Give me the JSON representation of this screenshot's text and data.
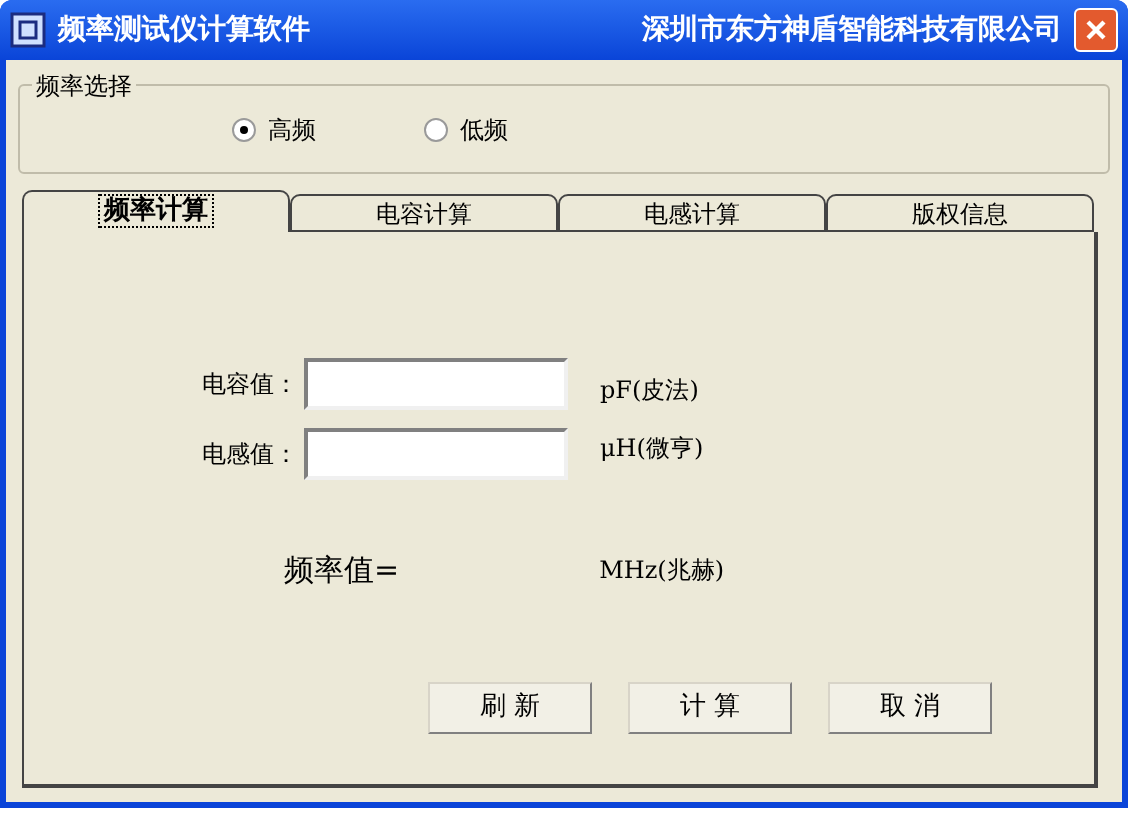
{
  "window": {
    "title": "频率测试仪计算软件",
    "company": "深圳市东方神盾智能科技有限公司"
  },
  "frequency_group": {
    "label": "频率选择",
    "options": [
      {
        "label": "高频",
        "selected": true
      },
      {
        "label": "低频",
        "selected": false
      }
    ]
  },
  "tabs": [
    {
      "label": "频率计算",
      "selected": true
    },
    {
      "label": "电容计算",
      "selected": false
    },
    {
      "label": "电感计算",
      "selected": false
    },
    {
      "label": "版权信息",
      "selected": false
    }
  ],
  "fields": [
    {
      "label": "电容值：",
      "unit": "pF(皮法)"
    },
    {
      "label": "电感值：",
      "unit": "μH(微亨)"
    }
  ],
  "result": {
    "label": "频率值=",
    "unit": "MHz(兆赫)"
  },
  "buttons": [
    "刷 新",
    "计 算",
    "取 消"
  ]
}
